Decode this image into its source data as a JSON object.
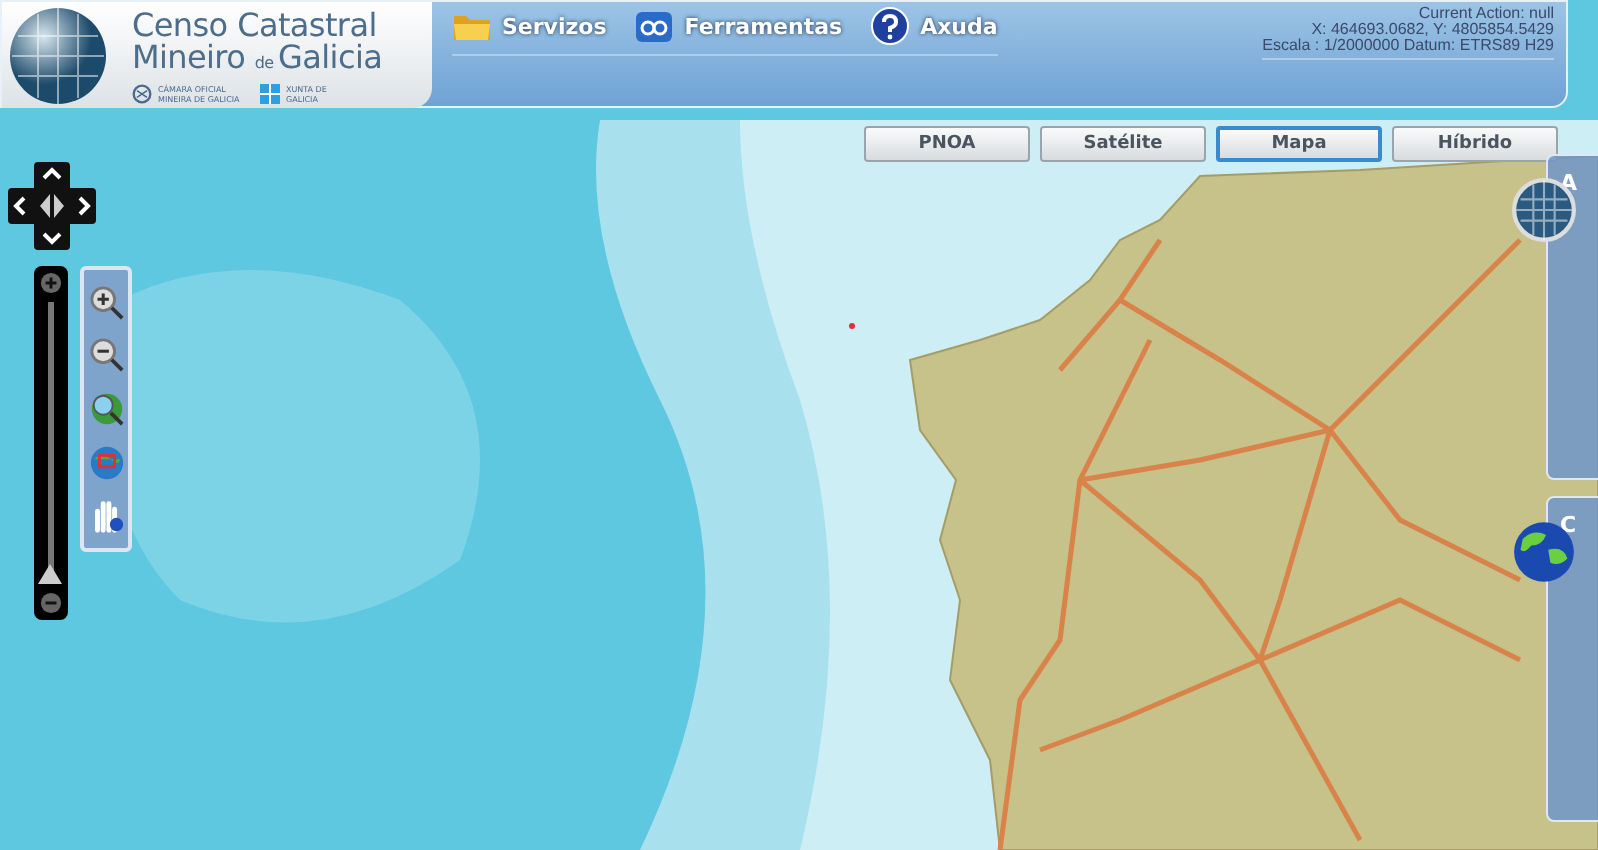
{
  "header": {
    "logo": {
      "line1": "Censo Catastral",
      "line2_start": "Mineiro",
      "line2_small": "de",
      "line2_end": "Galicia",
      "partner_1": "CÁMARA OFICIAL MINEIRA DE GALICIA",
      "partner_2": "XUNTA DE GALICIA"
    },
    "menu": [
      {
        "label": "Servizos",
        "kind": "folder"
      },
      {
        "label": "Ferramentas",
        "kind": "tools"
      },
      {
        "label": "Axuda",
        "kind": "help"
      }
    ],
    "status": [
      "Current Action: null",
      "X: 464693.0682, Y: 4805854.5429",
      "Escala : 1/2000000 Datum: ETRS89 H29"
    ]
  },
  "layer_tabs": [
    {
      "label": "PNOA",
      "selected": false
    },
    {
      "label": "Satélite",
      "selected": false
    },
    {
      "label": "Mapa",
      "selected": true
    },
    {
      "label": "Híbrido",
      "selected": false
    }
  ],
  "zoom_slider": {
    "level": 0.0
  },
  "tools": [
    {
      "kind": "zoom-in"
    },
    {
      "kind": "zoom-out"
    },
    {
      "kind": "zoom-extent"
    },
    {
      "kind": "zoom-box"
    },
    {
      "kind": "info"
    }
  ],
  "side_panels": [
    {
      "title": "A",
      "kind": "grid-globe"
    },
    {
      "title": "C",
      "kind": "earth"
    }
  ]
}
